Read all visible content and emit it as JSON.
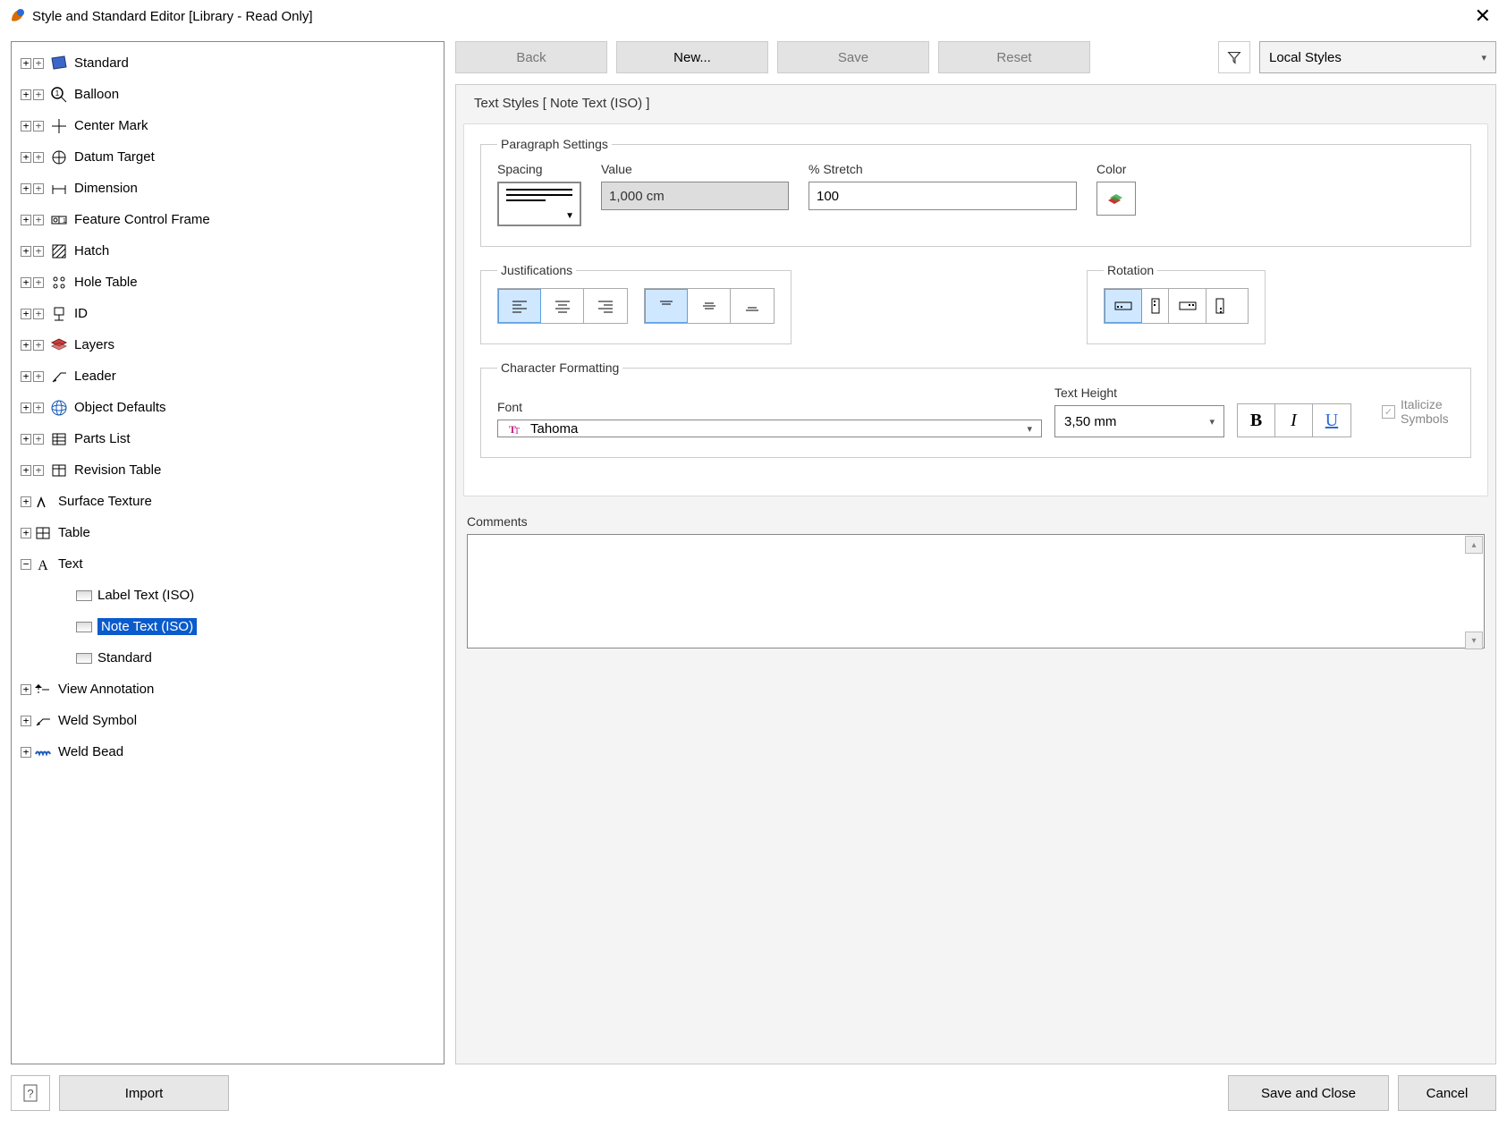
{
  "window": {
    "title": "Style and Standard Editor [Library - Read Only]"
  },
  "toolbar": {
    "back": "Back",
    "new": "New...",
    "save": "Save",
    "reset": "Reset",
    "styles_filter": "Local Styles"
  },
  "tree": {
    "items": [
      {
        "label": "Standard",
        "icon": "book"
      },
      {
        "label": "Balloon",
        "icon": "balloon"
      },
      {
        "label": "Center Mark",
        "icon": "centermark"
      },
      {
        "label": "Datum Target",
        "icon": "datum"
      },
      {
        "label": "Dimension",
        "icon": "dim"
      },
      {
        "label": "Feature Control Frame",
        "icon": "fcf"
      },
      {
        "label": "Hatch",
        "icon": "hatch"
      },
      {
        "label": "Hole Table",
        "icon": "holetable"
      },
      {
        "label": "ID",
        "icon": "id"
      },
      {
        "label": "Layers",
        "icon": "layers"
      },
      {
        "label": "Leader",
        "icon": "leader"
      },
      {
        "label": "Object Defaults",
        "icon": "globe"
      },
      {
        "label": "Parts List",
        "icon": "partslist"
      },
      {
        "label": "Revision Table",
        "icon": "revtable"
      },
      {
        "label": "Surface Texture",
        "icon": "surface"
      },
      {
        "label": "Table",
        "icon": "table"
      },
      {
        "label": "Text",
        "icon": "text",
        "expanded": true,
        "children": [
          {
            "label": "Label Text (ISO)"
          },
          {
            "label": "Note Text (ISO)",
            "selected": true
          },
          {
            "label": "Standard"
          }
        ]
      },
      {
        "label": "View Annotation",
        "icon": "viewann"
      },
      {
        "label": "Weld Symbol",
        "icon": "weldsym"
      },
      {
        "label": "Weld Bead",
        "icon": "weldbead"
      }
    ]
  },
  "panel": {
    "section_title": "Text Styles [ Note Text (ISO) ]",
    "paragraph": {
      "legend": "Paragraph Settings",
      "spacing_label": "Spacing",
      "value_label": "Value",
      "value": "1,000 cm",
      "stretch_label": "% Stretch",
      "stretch": "100",
      "color_label": "Color"
    },
    "just": {
      "legend": "Justifications"
    },
    "rot": {
      "legend": "Rotation"
    },
    "char": {
      "legend": "Character Formatting",
      "font_label": "Font",
      "font": "Tahoma",
      "height_label": "Text Height",
      "height": "3,50 mm",
      "italicize": "Italicize Symbols"
    },
    "comments_label": "Comments",
    "comments": ""
  },
  "footer": {
    "import": "Import",
    "save_close": "Save and Close",
    "cancel": "Cancel"
  }
}
